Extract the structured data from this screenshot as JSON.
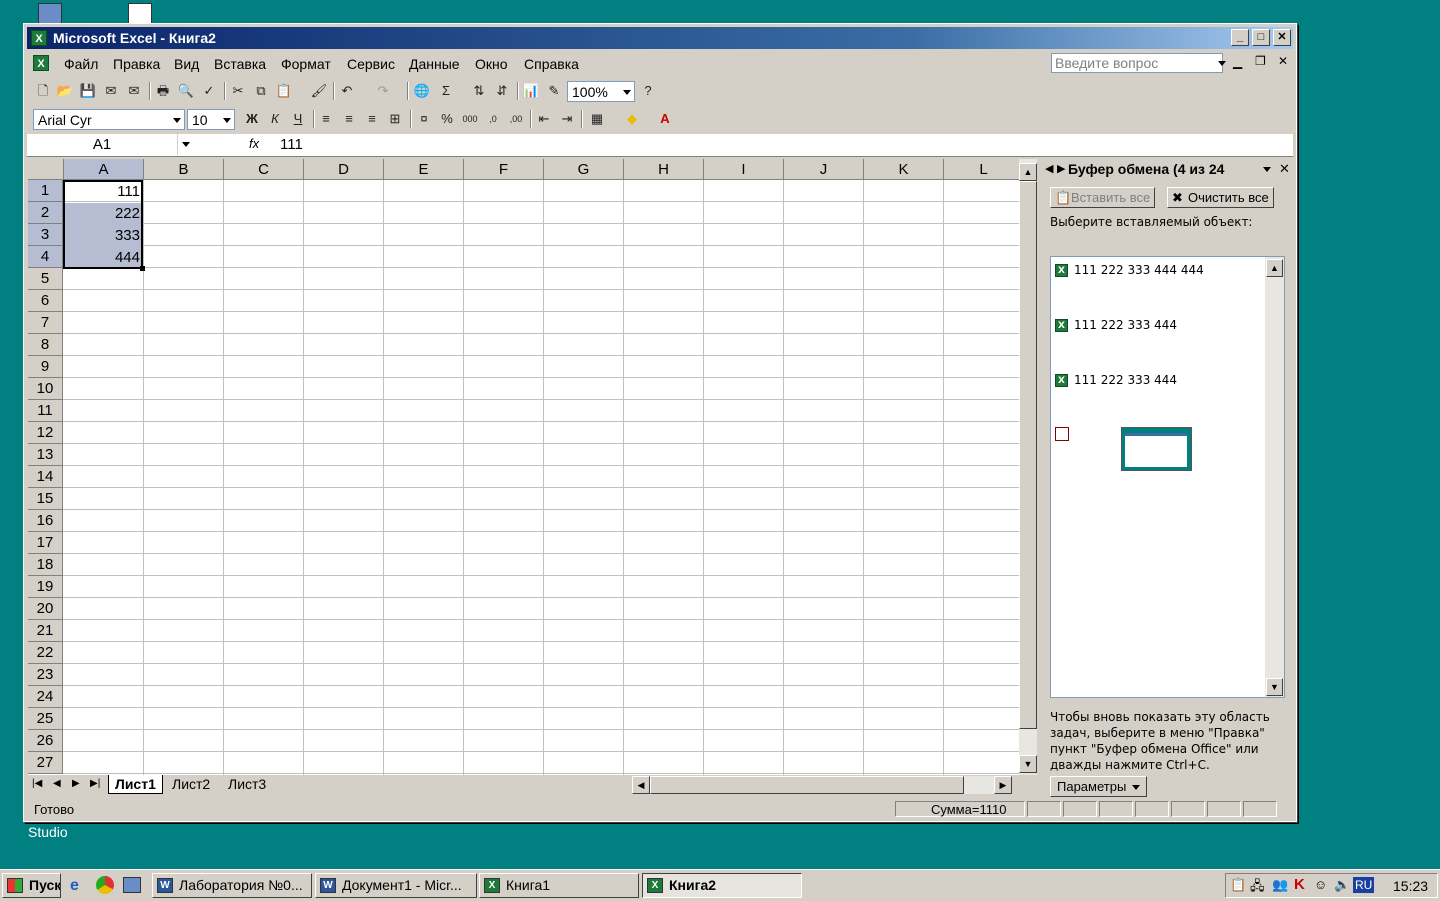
{
  "desktop": {
    "labels": [
      "Studio"
    ]
  },
  "window": {
    "title": "Microsoft Excel - Книга2"
  },
  "menu": {
    "items": [
      "Файл",
      "Правка",
      "Вид",
      "Вставка",
      "Формат",
      "Сервис",
      "Данные",
      "Окно",
      "Справка"
    ],
    "ask_placeholder": "Введите вопрос"
  },
  "toolbar": {
    "zoom": "100%"
  },
  "format_toolbar": {
    "font": "Arial Cyr",
    "size": "10",
    "bold": "Ж",
    "italic": "К",
    "underline": "Ч"
  },
  "formula_bar": {
    "name_box": "A1",
    "fx": "fx",
    "value": "111"
  },
  "sheet": {
    "columns": [
      "A",
      "B",
      "C",
      "D",
      "E",
      "F",
      "G",
      "H",
      "I",
      "J",
      "K",
      "L"
    ],
    "rows": [
      "1",
      "2",
      "3",
      "4",
      "5",
      "6",
      "7",
      "8",
      "9",
      "10",
      "11",
      "12",
      "13",
      "14",
      "15",
      "16",
      "17",
      "18",
      "19",
      "20",
      "21",
      "22",
      "23",
      "24",
      "25",
      "26",
      "27"
    ],
    "cells": {
      "A1": "111",
      "A2": "222",
      "A3": "333",
      "A4": "444"
    },
    "tabs": [
      "Лист1",
      "Лист2",
      "Лист3"
    ]
  },
  "status": {
    "ready": "Готово",
    "sum": "Сумма=1110"
  },
  "task_pane": {
    "title": "Буфер обмена (4 из 24",
    "paste_all": "Вставить все",
    "clear_all": "Очистить все",
    "prompt": "Выберите вставляемый объект:",
    "clips": [
      "111 222 333 444 444",
      "111 222 333 444",
      "111 222 333 444"
    ],
    "hint": "Чтобы вновь показать эту область задач, выберите в меню \"Правка\" пункт \"Буфер обмена Office\" или дважды нажмите Ctrl+C.",
    "options": "Параметры"
  },
  "taskbar": {
    "start": "Пуск",
    "tasks": [
      "Лаборатория №0...",
      "Документ1 - Micr...",
      "Книга1",
      "Книга2"
    ],
    "lang": "RU",
    "clock": "15:23"
  }
}
